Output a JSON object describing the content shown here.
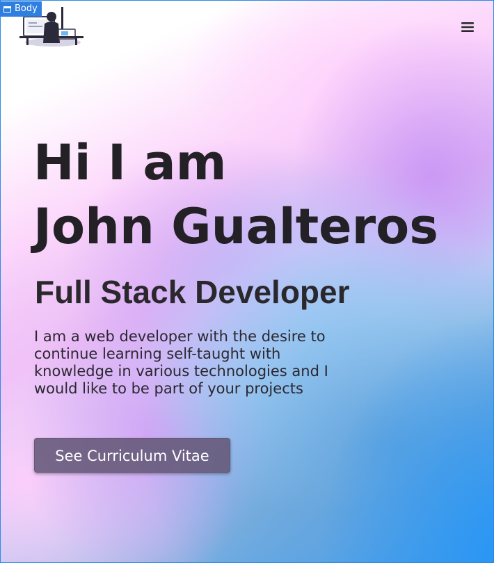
{
  "inspector": {
    "label": "Body",
    "icon": "window-icon"
  },
  "header": {
    "logo_icon": "developer-at-desk-illustration",
    "menu_icon": "hamburger-menu-icon"
  },
  "hero": {
    "greeting": "Hi I am",
    "name": "John Gualteros",
    "role": "Full Stack Developer",
    "description": "I am a web developer with the desire to continue learning self-taught with knowledge in various technologies and I would like to be part of your projects",
    "cta_label": "See Curriculum Vitae"
  },
  "colors": {
    "text": "#232126",
    "button_bg": "#645878",
    "accent_blue": "#2896f5",
    "accent_pink": "#fcd6fb",
    "accent_purple": "#c896f5"
  }
}
